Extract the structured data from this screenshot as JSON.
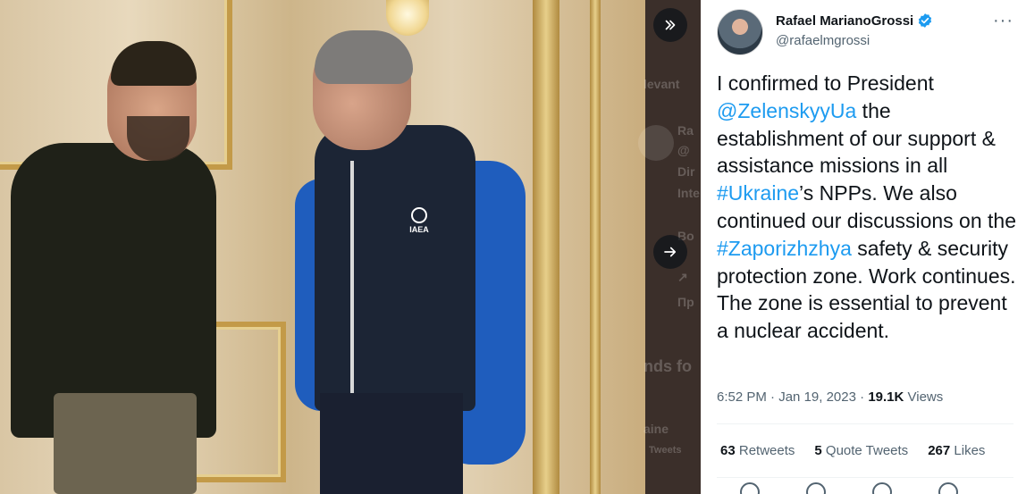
{
  "viewer": {
    "nav_back_icon": "chevrons-right-icon",
    "nav_next_icon": "arrow-right-icon",
    "photo_badge_text": "IAEA",
    "background_ghost_text": [
      "levant",
      "Ra",
      "@",
      "Dir",
      "Inte",
      "Bo",
      "↗",
      "Пр",
      "nds fo",
      "aine",
      "Tweets"
    ]
  },
  "tweet": {
    "author_name": "Rafael MarianoGrossi",
    "author_handle": "@rafaelmgrossi",
    "verified_icon": "verified-badge-icon",
    "more_icon": "more-dots-icon",
    "more_label": "···",
    "body_parts": [
      {
        "text": "I confirmed to President ",
        "link": false
      },
      {
        "text": "@ZelenskyyUa",
        "link": true
      },
      {
        "text": " the establishment of our support & assistance missions in all ",
        "link": false
      },
      {
        "text": "#Ukraine",
        "link": true
      },
      {
        "text": "’s NPPs. We also continued our discussions on the ",
        "link": false
      },
      {
        "text": "#Zaporizhzhya",
        "link": true
      },
      {
        "text": " safety & security protection zone. Work continues. The zone is essential to prevent a nuclear accident.",
        "link": false
      }
    ],
    "time": "6:52 PM",
    "separator": " · ",
    "date": "Jan 19, 2023",
    "views_count": "19.1K",
    "views_label": "Views",
    "retweets_count": "63",
    "retweets_label": "Retweets",
    "quotes_count": "5",
    "quotes_label": "Quote Tweets",
    "likes_count": "267",
    "likes_label": "Likes"
  },
  "colors": {
    "link": "#1d9bf0",
    "verified": "#1d9bf0",
    "text_primary": "#0f1419",
    "text_secondary": "#536471"
  }
}
